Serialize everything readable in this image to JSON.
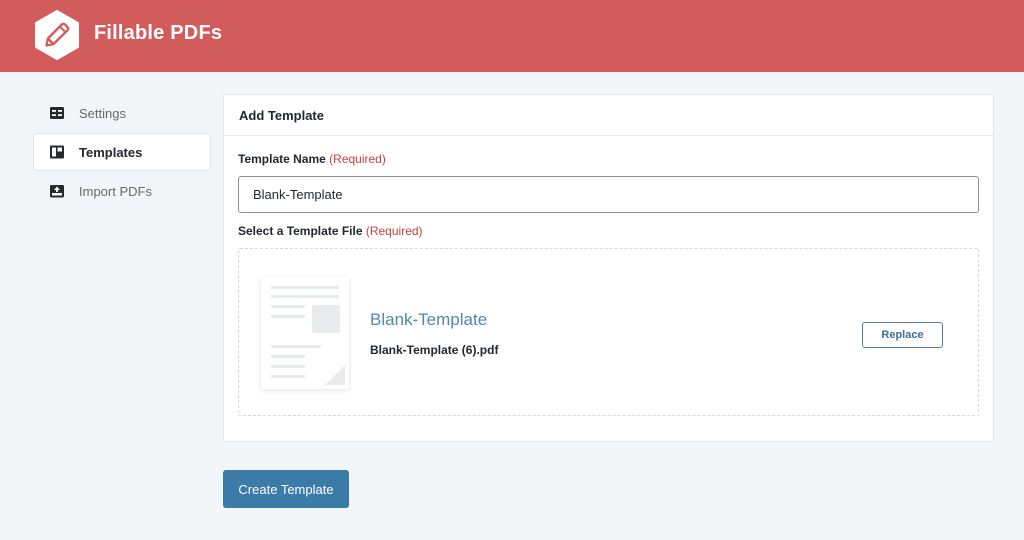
{
  "app": {
    "brand": "Fillable PDFs",
    "logo_icon": "pencil-hexagon-icon",
    "header_color": "#d25b5b"
  },
  "sidebar": {
    "items": [
      {
        "label": "Settings",
        "icon": "settings-icon",
        "active": false
      },
      {
        "label": "Templates",
        "icon": "templates-icon",
        "active": true
      },
      {
        "label": "Import PDFs",
        "icon": "import-icon",
        "active": false
      }
    ]
  },
  "panel": {
    "title": "Add Template",
    "template_name": {
      "label": "Template Name",
      "required": "(Required)",
      "value": "Blank-Template"
    },
    "template_file": {
      "label": "Select a Template File",
      "required": "(Required)",
      "file_title": "Blank-Template",
      "file_name": "Blank-Template (6).pdf",
      "replace_label": "Replace"
    }
  },
  "actions": {
    "create_label": "Create Template",
    "accent_color": "#3b7ba7"
  }
}
